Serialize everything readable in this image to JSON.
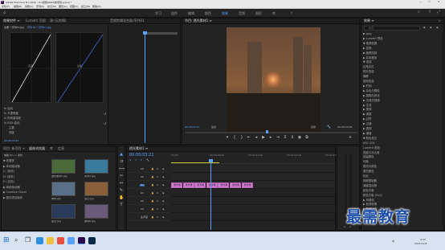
{
  "app": {
    "title": "Adobe Premiere Pro 2020 - D:\\视频\\0005\\新项目.prproj *",
    "win_min": "—",
    "win_max": "☐",
    "win_close": "✕"
  },
  "menu": [
    "文件(F)",
    "编辑(E)",
    "剪辑(C)",
    "序列(S)",
    "标记(M)",
    "图形(G)",
    "视图(V)",
    "窗口(W)",
    "帮助(H)"
  ],
  "workspaces": [
    {
      "label": "学习"
    },
    {
      "label": "组件"
    },
    {
      "label": "编辑"
    },
    {
      "label": "颜色"
    },
    {
      "label": "效果",
      "active": true
    },
    {
      "label": "音频"
    },
    {
      "label": "图形"
    },
    {
      "label": "库"
    }
  ],
  "effect_controls": {
    "tabs": [
      "效果控件 ≡",
      "Lumetri 范围",
      "源:(无剪辑)",
      "音频剪辑混合器:序列01"
    ],
    "clip_label": "主要 * 序列01.jpg",
    "seq_label": "序列 01 * 序列01.jpg",
    "curve_labels": [
      "亮度",
      "蓝色"
    ],
    "rows": [
      "fx 运动",
      "fx 不透明度",
      "fx 时间重映射",
      "fx RGB 曲线",
      "主要",
      "亮度"
    ],
    "timecode": "00:00:03:21"
  },
  "program": {
    "tab": "节目: 透光素材1 ≡",
    "timecode": "00:00:03:21",
    "fit": "适合",
    "quality": "完整",
    "duration": "00:00:03:08"
  },
  "effects_panel": {
    "tab": "效果 ≡",
    "search_placeholder": "搜索",
    "items": [
      "▶ 预设",
      "▶ Lumetri 预设",
      "▼ 视频效果",
      "  ▶ 变换",
      "  ▶ 图像控制",
      "  ▶ 实用程序",
      "  ▼ 扭曲",
      "      边角定位",
      "      镜头扭曲",
      "      偏移",
      "      旋转扭曲",
      "  ▶ 时间",
      "  ▶ 杂色与颗粒",
      "  ▶ 模糊与锐化",
      "  ▶ 沉浸式视频",
      "  ▶ 生成",
      "  ▶ 视频",
      "  ▶ 调整",
      "  ▶ 过时",
      "  ▶ 过渡",
      "  ▶ 透视",
      "  ▶ 通道",
      "  ▼ 颜色校正",
      "      ASC CDL",
      "      Lumetri 颜色",
      "      亮度与对比度",
      "      保留颜色",
      "      均衡",
      "      更改为颜色",
      "      更改颜色",
      "      色彩",
      "      视频限制器",
      "      通道混合器",
      "      颜色平衡",
      "      颜色平衡 (HLS)",
      "  ▶ 风格化",
      "▶ 音频效果",
      "▶ 音频过渡",
      "▶ 视频过渡"
    ]
  },
  "project": {
    "tabs": [
      "项目: 新项目 ≡",
      "媒体浏览器",
      "库",
      "信息"
    ],
    "path": "电脑 (D:) > 素材",
    "tree": [
      "▼ 收藏夹",
      "  ▶ 本地驱动器",
      "    C: (系统)",
      "    D: (软件)",
      "    E: (文档)",
      "▶ 网络驱动器",
      "▶ Creative Cloud",
      "  ▶ 团队项目版本"
    ],
    "thumbs": [
      {
        "label": "透光素材1.jpg",
        "dur": "5:00"
      },
      {
        "label": "风景2.jpg",
        "dur": "5:00"
      },
      {
        "label": "城市.jpg",
        "dur": "5:00"
      },
      {
        "label": "落日.jpg",
        "dur": "5:00"
      },
      {
        "label": "夜景.jpg",
        "dur": "5:00"
      },
      {
        "label": "素材6.jpg",
        "dur": "5:00"
      }
    ]
  },
  "timeline": {
    "tab": "透光素材1 ≡",
    "timecode": "00:00:03:21",
    "ruler": [
      "00:00",
      "00:00:05:00",
      "00:00:10:00",
      "00:00:15:00",
      "00:00:20:00"
    ],
    "tracks": [
      "V3",
      "V2",
      "V1",
      "A1",
      "A2",
      "A3",
      "主声道"
    ],
    "clips": [
      "透光素",
      "透光素",
      "透光素",
      "透光素",
      "透光素",
      "透光素",
      "透光素"
    ]
  },
  "taskbar": {
    "time": "9:43",
    "date": "2021/11/8",
    "lang": "中"
  },
  "watermark": "最需教育"
}
